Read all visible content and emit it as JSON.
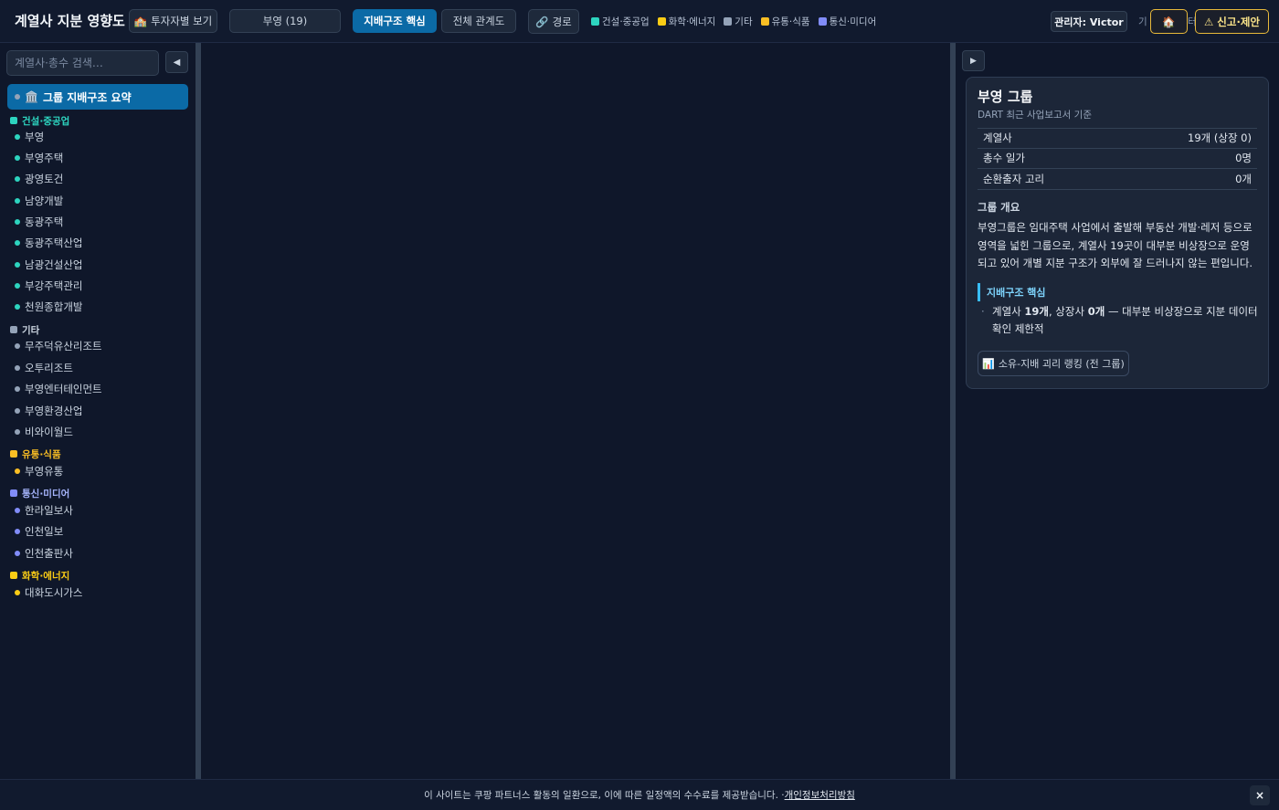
{
  "header": {
    "title": "계열사 지분 영향도",
    "investor_view": "투자자별 보기",
    "group_select": "부영 (19)",
    "tab_core": "지배구조 핵심",
    "tab_full": "전체 관계도",
    "path_button": "경로",
    "legend": [
      {
        "label": "건설·중공업",
        "color": "#2dd4bf"
      },
      {
        "label": "화학·에너지",
        "color": "#facc15"
      },
      {
        "label": "기타",
        "color": "#94a3b8"
      },
      {
        "label": "유통·식품",
        "color": "#fbbf24"
      },
      {
        "label": "통신·미디어",
        "color": "#818cf8"
      }
    ],
    "admin": "관리자: Victor",
    "partial_text_1": "기",
    "partial_text_2": "터",
    "report_button": "신고·제안"
  },
  "sidebar": {
    "search_placeholder": "계열사·총수 검색…",
    "summary_label": "그룹 지배구조 요약",
    "categories": [
      {
        "name": "건설·중공업",
        "color": "#2dd4bf",
        "items": [
          "부영",
          "부영주택",
          "광영토건",
          "남양개발",
          "동광주택",
          "동광주택산업",
          "남광건설산업",
          "부강주택관리",
          "천원종합개발"
        ]
      },
      {
        "name": "기타",
        "color": "#94a3b8",
        "items": [
          "무주덕유산리조트",
          "오투리조트",
          "부영엔터테인먼트",
          "부영환경산업",
          "비와이월드"
        ]
      },
      {
        "name": "유통·식품",
        "color": "#fbbf24",
        "items": [
          "부영유통"
        ]
      },
      {
        "name": "통신·미디어",
        "color": "#818cf8",
        "items": [
          "한라일보사",
          "인천일보",
          "인천출판사"
        ]
      },
      {
        "name": "화학·에너지",
        "color": "#facc15",
        "items": [
          "대화도시가스"
        ]
      }
    ]
  },
  "panel": {
    "title": "부영 그룹",
    "subtitle": "DART 최근 사업보고서 기준",
    "stats": [
      {
        "label": "계열사",
        "value": "19개 (상장 0)"
      },
      {
        "label": "총수 일가",
        "value": "0명"
      },
      {
        "label": "순환출자 고리",
        "value": "0개"
      }
    ],
    "overview_label": "그룹 개요",
    "overview_text": "부영그룹은 임대주택 사업에서 출발해 부동산 개발·레저 등으로 영역을 넓힌 그룹으로, 계열사 19곳이 대부분 비상장으로 운영되고 있어 개별 지분 구조가 외부에 잘 드러나지 않는 편입니다.",
    "core_label": "지배구조 핵심",
    "core_bullet": {
      "prefix": "계열사 ",
      "count": "19개",
      "mid": ", 상장사 ",
      "listed": "0개",
      "suffix": " — 대부분 비상장으로 지분 데이터 확인 제한적"
    },
    "rank_button": "소유-지배 괴리 랭킹 (전 그룹)"
  },
  "footer": {
    "text": "이 사이트는 쿠팡 파트너스 활동의 일환으로, 이에 따른 일정액의 수수료를 제공받습니다. · ",
    "link": "개인정보처리방침",
    "close": "×"
  }
}
